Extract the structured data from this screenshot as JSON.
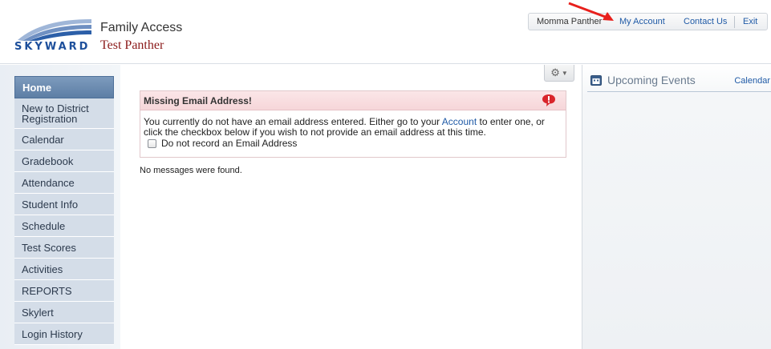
{
  "header": {
    "logo_text": "SKYWARD",
    "product_name": "Family Access",
    "student_name": "Test Panther"
  },
  "topbar": {
    "user": "Momma Panther",
    "my_account": "My Account",
    "contact_us": "Contact Us",
    "exit": "Exit"
  },
  "sidebar": {
    "items": [
      {
        "label": "Home"
      },
      {
        "label": "New to District Registration"
      },
      {
        "label": "Calendar"
      },
      {
        "label": "Gradebook"
      },
      {
        "label": "Attendance"
      },
      {
        "label": "Student Info"
      },
      {
        "label": "Schedule"
      },
      {
        "label": "Test Scores"
      },
      {
        "label": "Activities"
      },
      {
        "label": "REPORTS"
      },
      {
        "label": "Skylert"
      },
      {
        "label": "Login History"
      }
    ]
  },
  "main": {
    "alert": {
      "title": "Missing Email Address!",
      "text_before": "You currently do not have an email address entered. Either go to your ",
      "account_link": "Account",
      "text_after": " to enter one, or click the checkbox below if you wish to not provide an email address at this time.",
      "checkbox_label": "Do not record an Email Address"
    },
    "no_messages": "No messages were found."
  },
  "right_panel": {
    "title": "Upcoming Events",
    "calendar_link": "Calendar"
  },
  "colors": {
    "accent": "#1f5aa6",
    "active_nav": "#6a89af",
    "alert_header": "#f6d6d9",
    "student_name": "#8b1a1a"
  },
  "icons": [
    "skyward-logo",
    "gear-icon",
    "chevron-down-icon",
    "alert-icon",
    "calendar-icon",
    "arrow-annotation"
  ]
}
